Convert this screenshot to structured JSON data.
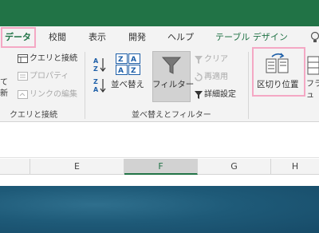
{
  "ribbon_tabs": {
    "data": "データ",
    "review": "校閲",
    "view": "表示",
    "developer": "開発",
    "help": "ヘルプ",
    "table_design": "テーブル デザイン",
    "lightbulb_icon": "lightbulb-icon"
  },
  "queries_group": {
    "partial_left_1": "て",
    "partial_left_2": "新",
    "queries_connections": "クエリと接続",
    "properties": "プロパティ",
    "edit_links": "リンクの編集",
    "label": "クエリと接続"
  },
  "sort_filter_group": {
    "sort_az": "A→Z",
    "sort_za": "Z→A",
    "sort": "並べ替え",
    "filter": "フィルター",
    "clear": "クリア",
    "reapply": "再適用",
    "advanced": "詳細設定",
    "label": "並べ替えとフィルター"
  },
  "data_tools_group": {
    "text_to_columns": "区切り位置",
    "flash_fill_partial": "フラッ",
    "flash_fill_partial2": "ュ"
  },
  "column_headers": [
    "E",
    "F",
    "G",
    "H"
  ],
  "colors": {
    "excel_green": "#217346",
    "highlight_pink": "#f4a8c4"
  }
}
